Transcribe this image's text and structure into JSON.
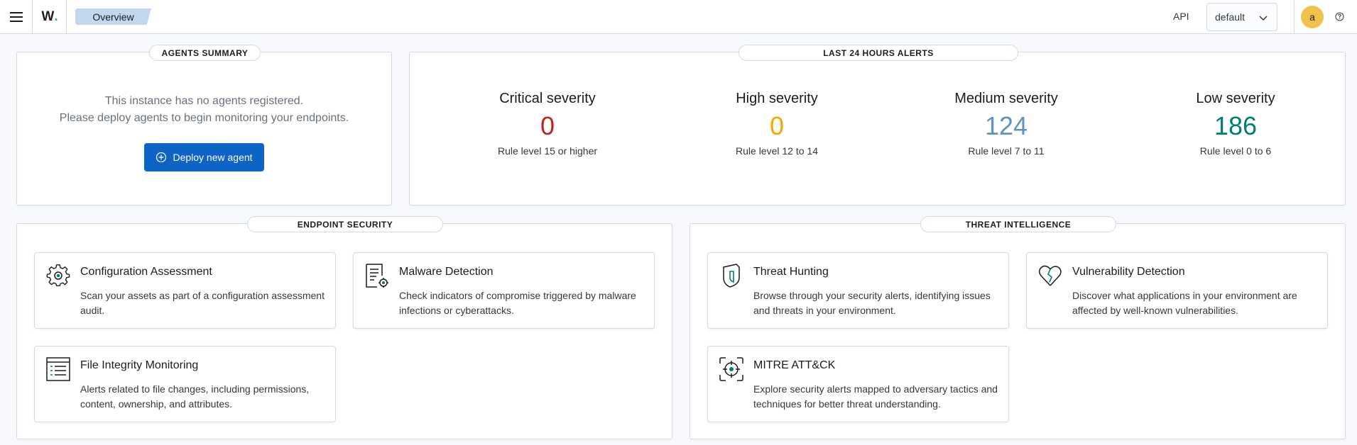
{
  "header": {
    "logo_text": "W",
    "logo_dot": ".",
    "breadcrumb": "Overview",
    "api_label": "API",
    "env_selected": "default",
    "avatar_initial": "a"
  },
  "agents_summary": {
    "title": "AGENTS SUMMARY",
    "message_line1": "This instance has no agents registered.",
    "message_line2": "Please deploy agents to begin monitoring your endpoints.",
    "deploy_button": "Deploy new agent"
  },
  "alerts": {
    "title": "LAST 24 HOURS ALERTS",
    "items": [
      {
        "label": "Critical severity",
        "value": "0",
        "desc": "Rule level 15 or higher",
        "color": "#bd271e"
      },
      {
        "label": "High severity",
        "value": "0",
        "desc": "Rule level 12 to 14",
        "color": "#f5a700"
      },
      {
        "label": "Medium severity",
        "value": "124",
        "desc": "Rule level 7 to 11",
        "color": "#6092c0"
      },
      {
        "label": "Low severity",
        "value": "186",
        "desc": "Rule level 0 to 6",
        "color": "#017d73"
      }
    ]
  },
  "endpoint_security": {
    "title": "ENDPOINT SECURITY",
    "cards": [
      {
        "title": "Configuration Assessment",
        "desc": "Scan your assets as part of a configuration assessment audit.",
        "icon": "gear-icon"
      },
      {
        "title": "Malware Detection",
        "desc": "Check indicators of compromise triggered by malware infections or cyberattacks.",
        "icon": "document-gear-icon"
      },
      {
        "title": "File Integrity Monitoring",
        "desc": "Alerts related to file changes, including permissions, content, ownership, and attributes.",
        "icon": "list-icon"
      }
    ]
  },
  "threat_intelligence": {
    "title": "THREAT INTELLIGENCE",
    "cards": [
      {
        "title": "Threat Hunting",
        "desc": "Browse through your security alerts, identifying issues and threats in your environment.",
        "icon": "shield-icon"
      },
      {
        "title": "Vulnerability Detection",
        "desc": "Discover what applications in your environment are affected by well-known vulnerabilities.",
        "icon": "heart-broken-icon"
      },
      {
        "title": "MITRE ATT&CK",
        "desc": "Explore security alerts mapped to adversary tactics and techniques for better threat understanding.",
        "icon": "crosshair-icon"
      }
    ]
  },
  "colors": {
    "accent": "#0b64c6",
    "icon_teal": "#017d73",
    "avatar": "#f0c24d",
    "breadcrumb_bg": "#c2d7ec"
  }
}
